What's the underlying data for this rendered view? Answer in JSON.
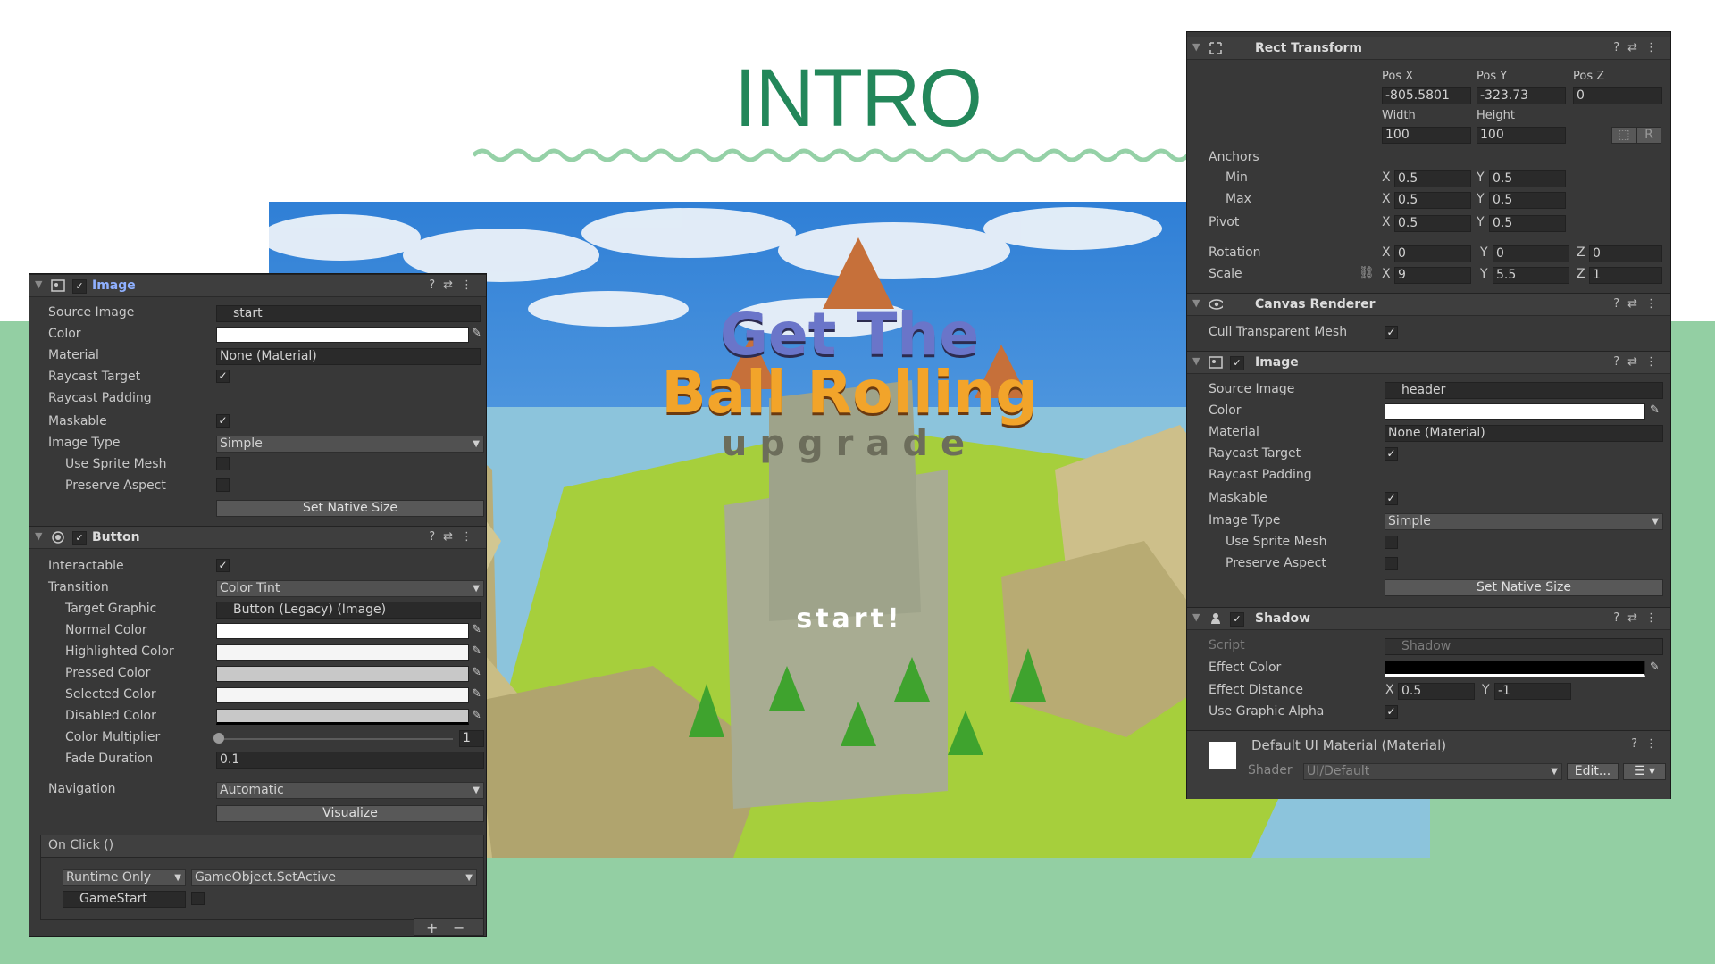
{
  "slide": {
    "title": "INTRO"
  },
  "game": {
    "title_line1": "Get The",
    "title_line2": "Ball Rolling",
    "title_line3": "upgrade",
    "start_label": "start!"
  },
  "left_panel": {
    "image": {
      "title": "Image",
      "rows": {
        "source_image_label": "Source Image",
        "source_image_value": "start",
        "color_label": "Color",
        "material_label": "Material",
        "material_value": "None (Material)",
        "raycast_target_label": "Raycast Target",
        "raycast_padding_label": "Raycast Padding",
        "maskable_label": "Maskable",
        "image_type_label": "Image Type",
        "image_type_value": "Simple",
        "use_sprite_mesh_label": "Use Sprite Mesh",
        "preserve_aspect_label": "Preserve Aspect",
        "set_native_size": "Set Native Size"
      }
    },
    "button": {
      "title": "Button",
      "interactable_label": "Interactable",
      "transition_label": "Transition",
      "transition_value": "Color Tint",
      "target_graphic_label": "Target Graphic",
      "target_graphic_value": "Button (Legacy) (Image)",
      "normal_color_label": "Normal Color",
      "highlighted_color_label": "Highlighted Color",
      "pressed_color_label": "Pressed Color",
      "selected_color_label": "Selected Color",
      "disabled_color_label": "Disabled Color",
      "color_multiplier_label": "Color Multiplier",
      "color_multiplier_value": "1",
      "fade_duration_label": "Fade Duration",
      "fade_duration_value": "0.1",
      "navigation_label": "Navigation",
      "navigation_value": "Automatic",
      "visualize": "Visualize",
      "on_click_label": "On Click ()",
      "runtime_value": "Runtime Only",
      "function_value": "GameObject.SetActive",
      "object_value": "GameStart",
      "plus": "+",
      "minus": "−"
    }
  },
  "right_panel": {
    "rect_transform": {
      "title": "Rect Transform",
      "pos_x_label": "Pos X",
      "pos_y_label": "Pos Y",
      "pos_z_label": "Pos Z",
      "pos_x": "-805.5801",
      "pos_y": "-323.73",
      "pos_z": "0",
      "width_label": "Width",
      "height_label": "Height",
      "width": "100",
      "height": "100",
      "r_button": "R",
      "anchors_label": "Anchors",
      "min_label": "Min",
      "min_x": "0.5",
      "min_y": "0.5",
      "max_label": "Max",
      "max_x": "0.5",
      "max_y": "0.5",
      "pivot_label": "Pivot",
      "pivot_x": "0.5",
      "pivot_y": "0.5",
      "rotation_label": "Rotation",
      "rot_x": "0",
      "rot_y": "0",
      "rot_z": "0",
      "scale_label": "Scale",
      "scale_x": "9",
      "scale_y": "5.5",
      "scale_z": "1",
      "x": "X",
      "y": "Y",
      "z": "Z"
    },
    "canvas_renderer": {
      "title": "Canvas Renderer",
      "cull_label": "Cull Transparent Mesh"
    },
    "image": {
      "title": "Image",
      "source_image_label": "Source Image",
      "source_image_value": "header",
      "color_label": "Color",
      "material_label": "Material",
      "material_value": "None (Material)",
      "raycast_target_label": "Raycast Target",
      "raycast_padding_label": "Raycast Padding",
      "maskable_label": "Maskable",
      "image_type_label": "Image Type",
      "image_type_value": "Simple",
      "use_sprite_mesh_label": "Use Sprite Mesh",
      "preserve_aspect_label": "Preserve Aspect",
      "set_native_size": "Set Native Size"
    },
    "shadow": {
      "title": "Shadow",
      "script_label": "Script",
      "script_value": "Shadow",
      "effect_color_label": "Effect Color",
      "effect_distance_label": "Effect Distance",
      "dist_x": "0.5",
      "dist_y": "-1",
      "use_graphic_alpha_label": "Use Graphic Alpha"
    },
    "material": {
      "title": "Default UI Material (Material)",
      "shader_label": "Shader",
      "shader_value": "UI/Default",
      "edit_button": "Edit..."
    }
  },
  "colors": {
    "slide_green": "#93cfa3",
    "title_green": "#23875a",
    "panel_bg": "#383838"
  },
  "icons": [
    "image-component-icon",
    "button-component-icon",
    "rect-transform-icon",
    "eye-icon",
    "shadow-icon",
    "help-icon",
    "preset-icon",
    "kebab-menu-icon",
    "eyedropper-icon",
    "object-picker-icon",
    "unlink-icon"
  ]
}
